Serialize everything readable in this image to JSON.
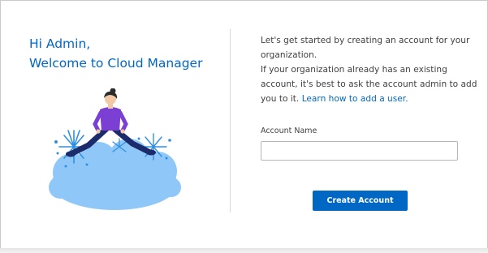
{
  "welcome": {
    "line1": "Hi Admin,",
    "line2": "Welcome to Cloud Manager"
  },
  "intro": {
    "line1": "Let's get started by creating an account for your",
    "line2": "organization.",
    "line3": "If your organization already has an existing",
    "line4": "account, it's best to ask the account admin to add",
    "line5_prefix": "you to it.",
    "link_text": "Learn how to add a user."
  },
  "form": {
    "account_name_label": "Account Name",
    "account_name_value": ""
  },
  "actions": {
    "create_account_label": "Create Account"
  },
  "colors": {
    "brand_blue": "#0067c5",
    "cloud": "#8fc8f8",
    "firework": "#2f8fe0",
    "shirt": "#7b3fd3",
    "pants": "#1b2b6b"
  },
  "illustration": {
    "icon": "celebration-illustration"
  }
}
